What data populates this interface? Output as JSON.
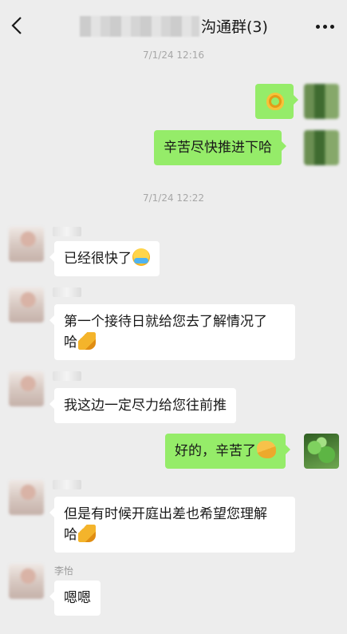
{
  "header": {
    "title": "沟通群(3)",
    "back_icon": "chevron-left-icon",
    "more_icon": "more-dots-icon"
  },
  "messages": [
    {
      "type": "timestamp",
      "text": "7/1/24 12:16"
    },
    {
      "type": "out",
      "text": "",
      "emoji": "ok-hand-emoji"
    },
    {
      "type": "out",
      "text": "辛苦尽快推进下哈"
    },
    {
      "type": "timestamp",
      "text": "7/1/24 12:22"
    },
    {
      "type": "in",
      "text": "已经很快了",
      "emoji": "crying-face-emoji"
    },
    {
      "type": "in",
      "lines": [
        "第一个接待日就给您去了解情况了",
        "哈"
      ],
      "emoji": "bowing-emoji"
    },
    {
      "type": "in",
      "text": "我这边一定尽力给您往前推"
    },
    {
      "type": "out",
      "text": "好的，辛苦了",
      "emoji": "handshake-emoji"
    },
    {
      "type": "in",
      "lines": [
        "但是有时候开庭出差也希望您理解",
        "哈"
      ],
      "emoji": "bowing-emoji"
    },
    {
      "type": "in",
      "sender": "李怡",
      "text": "嗯嗯"
    }
  ],
  "colors": {
    "background": "#ededed",
    "outgoing_bubble": "#95ec69",
    "incoming_bubble": "#ffffff",
    "timestamp": "#a7a7a7"
  }
}
